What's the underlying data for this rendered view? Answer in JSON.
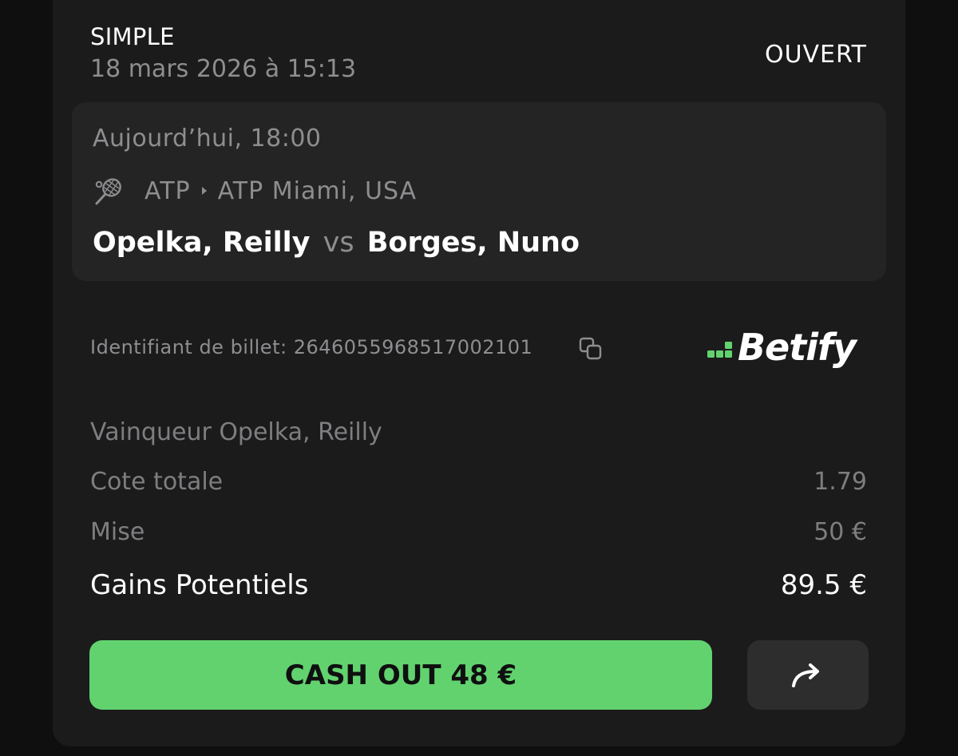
{
  "header": {
    "bet_type": "SIMPLE",
    "date": "18 mars 2026 à 15:13",
    "status": "OUVERT"
  },
  "event": {
    "time": "Aujourd’hui, 18:00",
    "sport_icon": "tennis-racket-icon",
    "league": "ATP",
    "tournament": "ATP Miami, USA",
    "player_home": "Opelka, Reilly",
    "vs": "vs",
    "player_away": "Borges, Nuno"
  },
  "ticket": {
    "label": "Identifiant de billet: 2646055968517002101",
    "copy_icon": "copy-icon"
  },
  "brand": {
    "name": "Betify",
    "accent": "#62d26f"
  },
  "details": {
    "selection": "Vainqueur Opelka, Reilly",
    "odds_label": "Cote totale",
    "odds_value": "1.79",
    "stake_label": "Mise",
    "stake_value": "50 €",
    "gains_label": "Gains Potentiels",
    "gains_value": "89.5 €"
  },
  "actions": {
    "cashout_label": "CASH OUT 48 €",
    "cashout_color": "#62d26f",
    "share_icon": "share-arrow-icon"
  }
}
